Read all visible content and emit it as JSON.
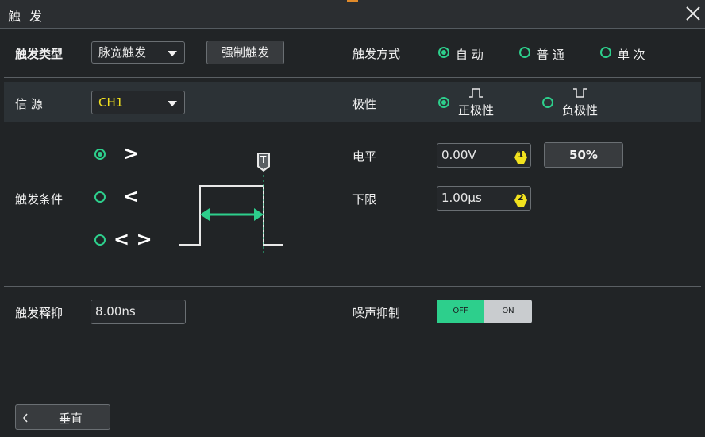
{
  "window": {
    "title": "触 发"
  },
  "trigger_type": {
    "label": "触发类型",
    "value": "脉宽触发",
    "force_button": "强制触发"
  },
  "trigger_mode": {
    "label": "触发方式",
    "options": [
      {
        "label": "自 动",
        "selected": true
      },
      {
        "label": "普 通",
        "selected": false
      },
      {
        "label": "单 次",
        "selected": false
      }
    ]
  },
  "source": {
    "label": "信 源",
    "value": "CH1",
    "value_color": "#f2e21e"
  },
  "polarity": {
    "label": "极性",
    "options": [
      {
        "label": "正极性",
        "icon": "positive-pulse-icon",
        "selected": true
      },
      {
        "label": "负极性",
        "icon": "negative-pulse-icon",
        "selected": false
      }
    ]
  },
  "condition": {
    "label": "触发条件",
    "options": [
      {
        "symbol": ">",
        "selected": true
      },
      {
        "symbol": "<",
        "selected": false
      },
      {
        "symbol": "< >",
        "selected": false
      }
    ],
    "cursor_label": "T"
  },
  "level": {
    "label": "电平",
    "value": "0.00V",
    "badge": "1",
    "fifty_button": "50%"
  },
  "lower_limit": {
    "label": "下限",
    "value": "1.00μs",
    "badge": "2"
  },
  "holdoff": {
    "label": "触发释抑",
    "value": "8.00ns"
  },
  "noise_reject": {
    "label": "噪声抑制",
    "off_label": "OFF",
    "on_label": "ON",
    "state": "off"
  },
  "footer": {
    "vertical_button": "垂直"
  },
  "colors": {
    "accent": "#2dcf8c",
    "badge": "#f2e21e",
    "source": "#f2e21e"
  }
}
